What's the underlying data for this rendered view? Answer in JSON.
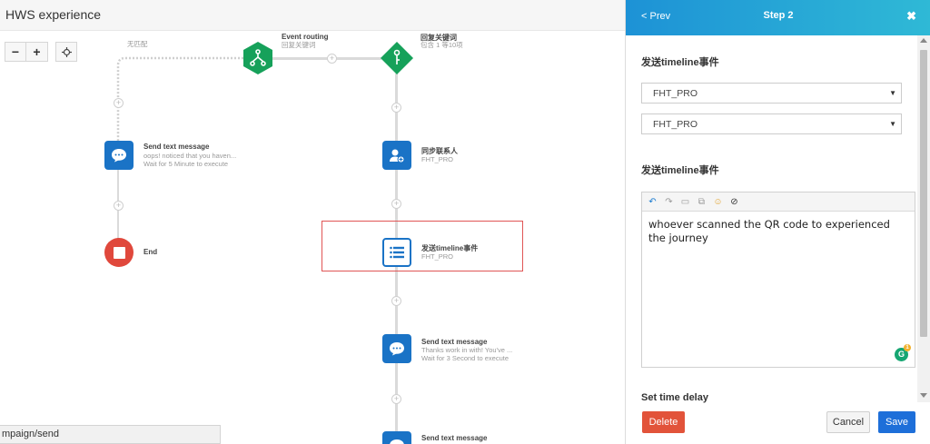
{
  "header": {
    "title": "HWS experience"
  },
  "canvas": {
    "zoom_out": "−",
    "zoom_in": "+",
    "no_match_label": "无匹配",
    "nodes": {
      "event_routing": {
        "title": "Event routing",
        "sub": "回复关键词"
      },
      "keyword_reply": {
        "title": "回复关键词",
        "sub": "包含 1 等10项"
      },
      "send_text_left": {
        "title": "Send text message",
        "sub1": "oops! noticed that you haven...",
        "sub2": "Wait for 5 Minute to execute"
      },
      "end": {
        "title": "End"
      },
      "sync_contact": {
        "title": "同步联系人",
        "sub": "FHT_PRO"
      },
      "timeline_event": {
        "title": "发送timeline事件",
        "sub": "FHT_PRO"
      },
      "send_text_mid": {
        "title": "Send text message",
        "sub1": "Thanks work in with! You've ...",
        "sub2": "Wait for 3 Second to execute"
      },
      "send_text_bottom": {
        "title": "Send text message"
      }
    },
    "status_url": "mpaign/send"
  },
  "panel": {
    "prev_label": "< Prev",
    "step_label": "Step 2",
    "close_label": "✖",
    "section1_label": "发送timeline事件",
    "select1_value": "FHT_PRO",
    "select2_value": "FHT_PRO",
    "section2_label": "发送timeline事件",
    "editor_text": "whoever scanned the QR code to experienced the journey",
    "section3_label": "Set time delay",
    "delete_label": "Delete",
    "cancel_label": "Cancel",
    "save_label": "Save",
    "grammarly_count": "1"
  },
  "colors": {
    "header_gradient_start": "#1d92d6",
    "header_gradient_end": "#2fb9d6",
    "node_blue": "#1a73c6",
    "node_green": "#16a15a",
    "end_red": "#e0483c",
    "delete_red": "#e2533a",
    "save_blue": "#1e6fd9",
    "selection_red": "#e05555"
  }
}
